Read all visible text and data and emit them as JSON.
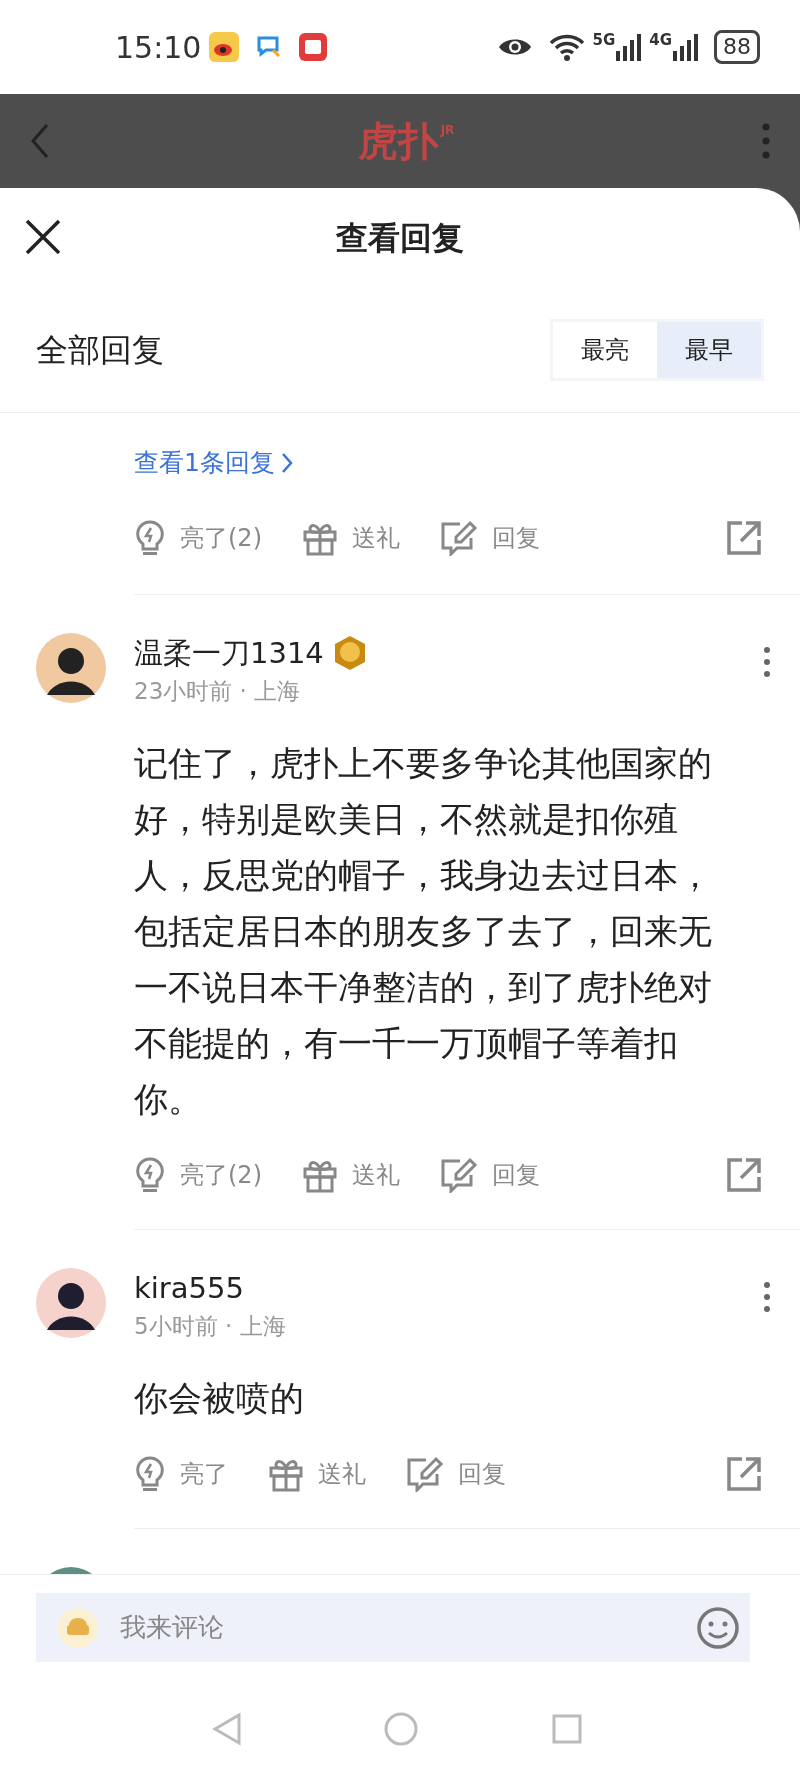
{
  "status_bar": {
    "time": "15:10",
    "network_labels": [
      "5G",
      "4G"
    ],
    "battery": "88"
  },
  "app_bar": {
    "logo": "虎扑",
    "logo_mark": "JR"
  },
  "sheet": {
    "title": "查看回复",
    "section_title": "全部回复",
    "sort_tabs": [
      {
        "label": "最亮",
        "selected": false
      },
      {
        "label": "最早",
        "selected": true
      }
    ]
  },
  "previous_comment": {
    "replies_link": "查看1条回复",
    "actions": {
      "light": "亮了(2)",
      "gift": "送礼",
      "reply": "回复"
    }
  },
  "comments": [
    {
      "kind": "full",
      "author": "温柔一刀1314",
      "has_badge": true,
      "meta": "23小时前 · 上海",
      "text": "记住了，虎扑上不要多争论其他国家的好，特别是欧美日，不然就是扣你殖人，反思党的帽子，我身边去过日本，包括定居日本的朋友多了去了，回来无一不说日本干净整洁的，到了虎扑绝对不能提的，有一千一万顶帽子等着扣你。",
      "actions": {
        "light": "亮了(2)",
        "gift": "送礼",
        "reply": "回复"
      }
    },
    {
      "kind": "full",
      "author": "kira555",
      "has_badge": false,
      "meta": "5小时前 · 上海",
      "text": "你会被喷的",
      "actions": {
        "light": "亮了",
        "gift": "送礼",
        "reply": "回复"
      }
    },
    {
      "kind": "cut_off"
    }
  ],
  "comment_box": {
    "placeholder": "我来评论"
  }
}
